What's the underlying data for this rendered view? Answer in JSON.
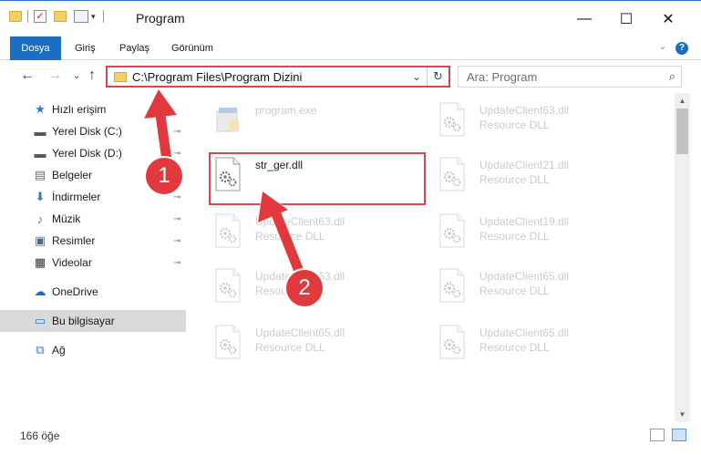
{
  "window": {
    "title": "Program",
    "minimize": "—",
    "maximize": "☐",
    "close": "✕"
  },
  "ribbon": {
    "tabs": [
      "Dosya",
      "Giriş",
      "Paylaş",
      "Görünüm"
    ],
    "chevron": "⌄",
    "help": "?"
  },
  "nav": {
    "back": "←",
    "forward": "→",
    "recent": "⌄",
    "up": "↑",
    "address": "C:\\Program Files\\Program Dizini",
    "address_dropdown": "⌄",
    "refresh": "↻",
    "search_placeholder": "Ara: Program",
    "search_icon": "⌕"
  },
  "sidebar": {
    "items": [
      {
        "label": "Hızlı erişim",
        "icon": "star-icon",
        "glyph": "★",
        "color": "#2b7bd6",
        "pinned": false
      },
      {
        "label": "Yerel Disk (C:)",
        "icon": "drive-icon",
        "glyph": "▬",
        "color": "#555555",
        "pinned": true
      },
      {
        "label": "Yerel Disk (D:)",
        "icon": "drive-icon",
        "glyph": "▬",
        "color": "#555555",
        "pinned": true
      },
      {
        "label": "Belgeler",
        "icon": "documents-icon",
        "glyph": "▤",
        "color": "#5a6f8c",
        "pinned": true
      },
      {
        "label": "İndirmeler",
        "icon": "downloads-icon",
        "glyph": "⬇",
        "color": "#2b7bd6",
        "pinned": true
      },
      {
        "label": "Müzik",
        "icon": "music-icon",
        "glyph": "♪",
        "color": "#2b7bd6",
        "pinned": true
      },
      {
        "label": "Resimler",
        "icon": "pictures-icon",
        "glyph": "▣",
        "color": "#4a6a8a",
        "pinned": true
      },
      {
        "label": "Videolar",
        "icon": "videos-icon",
        "glyph": "▦",
        "color": "#333333",
        "pinned": true
      },
      {
        "label": "OneDrive",
        "icon": "cloud-icon",
        "glyph": "☁",
        "color": "#1a6fc4",
        "pinned": false
      },
      {
        "label": "Bu bilgisayar",
        "icon": "computer-icon",
        "glyph": "▭",
        "color": "#2b7bd6",
        "pinned": false
      },
      {
        "label": "Ağ",
        "icon": "network-icon",
        "glyph": "⧉",
        "color": "#2b7bd6",
        "pinned": false
      }
    ],
    "pin_glyph": "📌"
  },
  "files": [
    {
      "name": "program.exe",
      "type": "",
      "faded": true
    },
    {
      "name": "UpdateClient63.dll",
      "type": "Resource DLL",
      "faded": true
    },
    {
      "name": "str_ger.dll",
      "type": "",
      "faded": false
    },
    {
      "name": "UpdateClient21.dll",
      "type": "Resource DLL",
      "faded": true
    },
    {
      "name": "UpdateClient63.dll",
      "type": "Resource DLL",
      "faded": true
    },
    {
      "name": "UpdateClient19.dll",
      "type": "Resource DLL",
      "faded": true
    },
    {
      "name": "UpdateClient63.dll",
      "type": "Resource DLL",
      "faded": true
    },
    {
      "name": "UpdateClient65.dll",
      "type": "Resource DLL",
      "faded": true
    },
    {
      "name": "UpdateClient65.dll",
      "type": "Resource DLL",
      "faded": true
    },
    {
      "name": "UpdateClient65.dll",
      "type": "Resource DLL",
      "faded": true
    }
  ],
  "status": {
    "count": "166 öğe"
  },
  "annotations": {
    "badge1": "1",
    "badge2": "2",
    "color": "#e0393e"
  }
}
